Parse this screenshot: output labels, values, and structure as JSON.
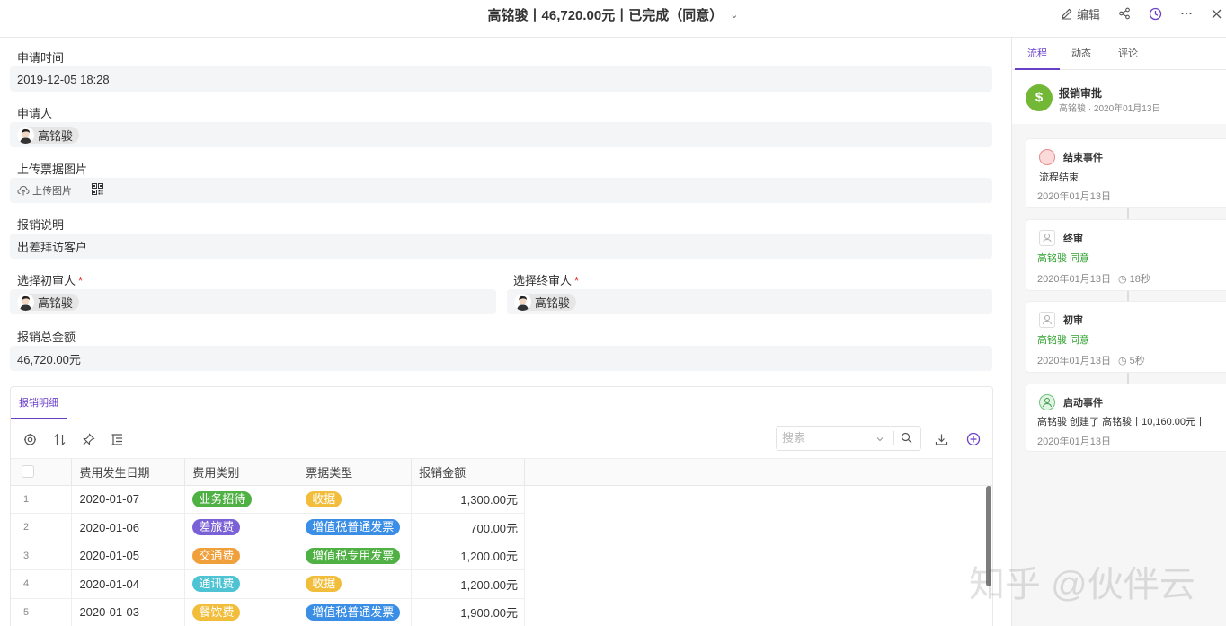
{
  "header": {
    "title": "高铭骏丨46,720.00元丨已完成（同意）",
    "edit_label": "编辑"
  },
  "form": {
    "apply_time_label": "申请时间",
    "apply_time_value": "2019-12-05 18:28",
    "applicant_label": "申请人",
    "applicant_value": "高铭骏",
    "upload_label": "上传票据图片",
    "upload_button": "上传图片",
    "description_label": "报销说明",
    "description_value": "出差拜访客户",
    "first_reviewer_label": "选择初审人",
    "first_reviewer_value": "高铭骏",
    "final_reviewer_label": "选择终审人",
    "final_reviewer_value": "高铭骏",
    "required_mark": "*",
    "total_label": "报销总金额",
    "total_value": "46,720.00元"
  },
  "detail": {
    "tab_label": "报销明细",
    "search_placeholder": "搜索",
    "columns": [
      "费用发生日期",
      "费用类别",
      "票据类型",
      "报销金额"
    ],
    "rows": [
      {
        "idx": "1",
        "date": "2020-01-07",
        "category": "业务招待",
        "category_color": "#4fb043",
        "invoice": "收据",
        "invoice_color": "#f2bd3a",
        "amount": "1,300.00元"
      },
      {
        "idx": "2",
        "date": "2020-01-06",
        "category": "差旅费",
        "category_color": "#7b61d6",
        "invoice": "增值税普通发票",
        "invoice_color": "#3a8ee6",
        "amount": "700.00元"
      },
      {
        "idx": "3",
        "date": "2020-01-05",
        "category": "交通费",
        "category_color": "#f0a03a",
        "invoice": "增值税专用发票",
        "invoice_color": "#4fb043",
        "amount": "1,200.00元"
      },
      {
        "idx": "4",
        "date": "2020-01-04",
        "category": "通讯费",
        "category_color": "#4ec3d4",
        "invoice": "收据",
        "invoice_color": "#f2bd3a",
        "amount": "1,200.00元"
      },
      {
        "idx": "5",
        "date": "2020-01-03",
        "category": "餐饮费",
        "category_color": "#f2bd3a",
        "invoice": "增值税普通发票",
        "invoice_color": "#3a8ee6",
        "amount": "1,900.00元"
      }
    ]
  },
  "right_panel": {
    "tabs": [
      "流程",
      "动态",
      "评论"
    ],
    "active_tab": "流程",
    "head_title": "报销审批",
    "head_sub": "高铭骏 · 2020年01月13日",
    "accent_color": "#6a3fc8",
    "events": [
      {
        "icon": "end-event-icon",
        "title": "结束事件",
        "line2": "流程结束",
        "line2_green": false,
        "date": "2020年01月13日",
        "duration": ""
      },
      {
        "icon": "user-icon",
        "title": "终审",
        "line2": "高铭骏 同意",
        "line2_green": true,
        "date": "2020年01月13日",
        "duration": "18秒"
      },
      {
        "icon": "user-icon",
        "title": "初审",
        "line2": "高铭骏 同意",
        "line2_green": true,
        "date": "2020年01月13日",
        "duration": "5秒"
      },
      {
        "icon": "start-event-icon",
        "title": "启动事件",
        "line2": "高铭骏 创建了 高铭骏丨10,160.00元丨",
        "line2_green": false,
        "date": "2020年01月13日",
        "duration": ""
      }
    ]
  },
  "watermark": "知乎 @伙伴云"
}
